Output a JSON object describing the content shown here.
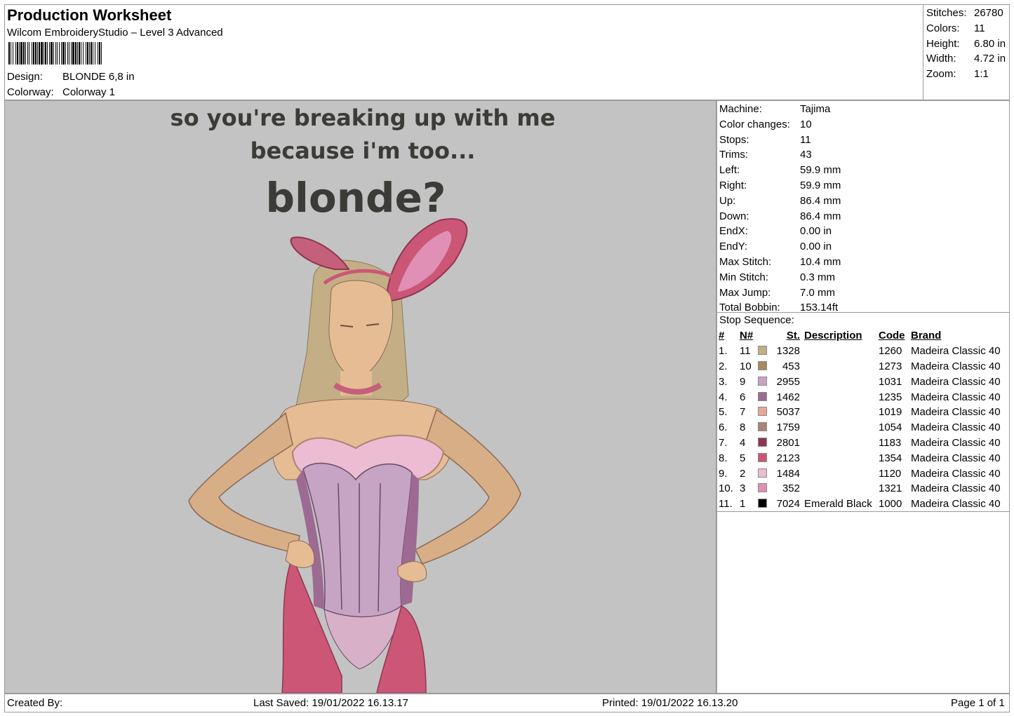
{
  "header": {
    "title": "Production Worksheet",
    "software": "Wilcom EmbroideryStudio – Level 3 Advanced",
    "design_label": "Design:",
    "design_value": "BLONDE 6,8 in",
    "colorway_label": "Colorway:",
    "colorway_value": "Colorway 1"
  },
  "summary": [
    {
      "label": "Stitches:",
      "value": "26780"
    },
    {
      "label": "Colors:",
      "value": "11"
    },
    {
      "label": "Height:",
      "value": "6.80 in"
    },
    {
      "label": "Width:",
      "value": "4.72 in"
    },
    {
      "label": "Zoom:",
      "value": "1:1"
    }
  ],
  "design_text": {
    "line1": "so you're breaking up with me",
    "line2": "because i'm too...",
    "line3": "blonde?"
  },
  "machine": [
    {
      "label": "Machine:",
      "value": "Tajima"
    },
    {
      "label": "Color changes:",
      "value": "10"
    },
    {
      "label": "Stops:",
      "value": "11"
    },
    {
      "label": "Trims:",
      "value": "43"
    },
    {
      "label": "Left:",
      "value": "59.9 mm"
    },
    {
      "label": "Right:",
      "value": "59.9 mm"
    },
    {
      "label": "Up:",
      "value": "86.4 mm"
    },
    {
      "label": "Down:",
      "value": "86.4 mm"
    },
    {
      "label": "EndX:",
      "value": "0.00 in"
    },
    {
      "label": "EndY:",
      "value": "0.00 in"
    },
    {
      "label": "Max Stitch:",
      "value": "10.4 mm"
    },
    {
      "label": "Min Stitch:",
      "value": "0.3 mm"
    },
    {
      "label": "Max Jump:",
      "value": "7.0 mm"
    },
    {
      "label": "Total Bobbin:",
      "value": "153.14ft"
    }
  ],
  "stop_sequence": {
    "title": "Stop Sequence:",
    "headers": {
      "num": "#",
      "n": "N#",
      "st": "St.",
      "desc": "Description",
      "code": "Code",
      "brand": "Brand"
    },
    "rows": [
      {
        "num": "1.",
        "n": "11",
        "color": "#c4ae86",
        "st": "1328",
        "desc": "",
        "code": "1260",
        "brand": "Madeira Classic 40"
      },
      {
        "num": "2.",
        "n": "10",
        "color": "#a88a5e",
        "st": "453",
        "desc": "",
        "code": "1273",
        "brand": "Madeira Classic 40"
      },
      {
        "num": "3.",
        "n": "9",
        "color": "#c6a4c4",
        "st": "2955",
        "desc": "",
        "code": "1031",
        "brand": "Madeira Classic 40"
      },
      {
        "num": "4.",
        "n": "6",
        "color": "#9c6a92",
        "st": "1462",
        "desc": "",
        "code": "1235",
        "brand": "Madeira Classic 40"
      },
      {
        "num": "5.",
        "n": "7",
        "color": "#e8a898",
        "st": "5037",
        "desc": "",
        "code": "1019",
        "brand": "Madeira Classic 40"
      },
      {
        "num": "6.",
        "n": "8",
        "color": "#aa8476",
        "st": "1759",
        "desc": "",
        "code": "1054",
        "brand": "Madeira Classic 40"
      },
      {
        "num": "7.",
        "n": "4",
        "color": "#8e3650",
        "st": "2801",
        "desc": "",
        "code": "1183",
        "brand": "Madeira Classic 40"
      },
      {
        "num": "8.",
        "n": "5",
        "color": "#cc5676",
        "st": "2123",
        "desc": "",
        "code": "1354",
        "brand": "Madeira Classic 40"
      },
      {
        "num": "9.",
        "n": "2",
        "color": "#ecbcd2",
        "st": "1484",
        "desc": "",
        "code": "1120",
        "brand": "Madeira Classic 40"
      },
      {
        "num": "10.",
        "n": "3",
        "color": "#e090b4",
        "st": "352",
        "desc": "",
        "code": "1321",
        "brand": "Madeira Classic 40"
      },
      {
        "num": "11.",
        "n": "1",
        "color": "#000000",
        "st": "7024",
        "desc": "Emerald Black",
        "code": "1000",
        "brand": "Madeira Classic 40"
      }
    ]
  },
  "footer": {
    "created_by": "Created By:",
    "last_saved": "Last Saved: 19/01/2022 16.13.17",
    "printed": "Printed: 19/01/2022 16.13.20",
    "page": "Page 1 of 1"
  }
}
